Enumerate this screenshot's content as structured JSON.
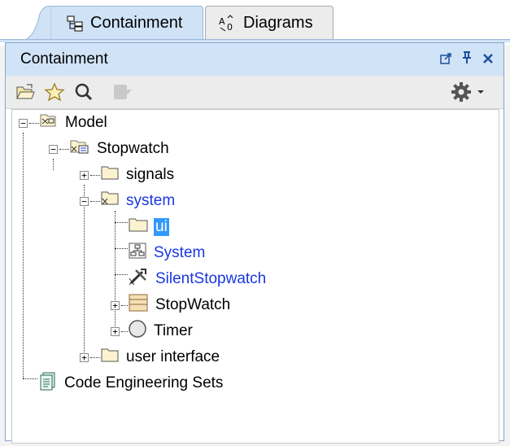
{
  "tabs": [
    {
      "label": "Containment",
      "icon": "containment-tree-icon",
      "active": true
    },
    {
      "label": "Diagrams",
      "icon": "diagrams-icon",
      "active": false
    }
  ],
  "panel": {
    "title": "Containment",
    "controls": [
      "float-icon",
      "pin-icon",
      "close-icon"
    ]
  },
  "toolbar": {
    "left_icons": [
      "open-folder-icon",
      "star-icon",
      "search-icon",
      "sync-icon"
    ],
    "right_icons": [
      "gear-icon",
      "dropdown-arrow-icon"
    ]
  },
  "tree": {
    "model": "Model",
    "stopwatch": "Stopwatch",
    "signals": "signals",
    "system": "system",
    "ui": "ui",
    "system_diagram": "System",
    "silent_stopwatch": "SilentStopwatch",
    "stopwatch_block": "StopWatch",
    "timer": "Timer",
    "user_interface": "user interface",
    "code_engineering_sets": "Code Engineering Sets"
  },
  "colors": {
    "active_tab": "#cfe2f6",
    "title_bar": "#d0e3f7",
    "selection": "#3399ff",
    "link_text": "#1a36e0"
  }
}
